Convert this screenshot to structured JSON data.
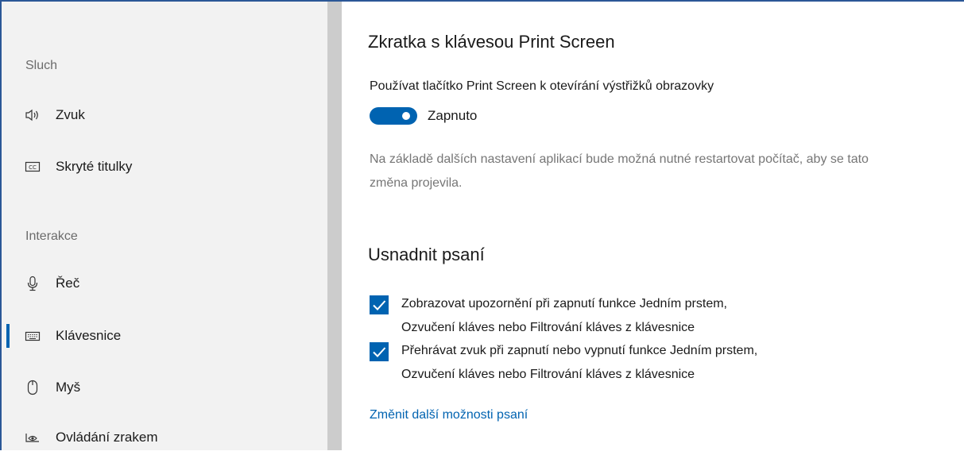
{
  "sidebar": {
    "groups": [
      {
        "label": "Sluch",
        "items": [
          {
            "label": "Zvuk",
            "icon": "speaker-icon"
          },
          {
            "label": "Skryté titulky",
            "icon": "closed-captions-icon"
          }
        ]
      },
      {
        "label": "Interakce",
        "items": [
          {
            "label": "Řeč",
            "icon": "microphone-icon"
          },
          {
            "label": "Klávesnice",
            "icon": "keyboard-icon",
            "selected": true
          },
          {
            "label": "Myš",
            "icon": "mouse-icon"
          },
          {
            "label": "Ovládání zrakem",
            "icon": "eye-control-icon"
          }
        ]
      }
    ]
  },
  "main": {
    "print_screen": {
      "heading": "Zkratka s klávesou Print Screen",
      "setting_label": "Používat tlačítko Print Screen k otevírání výstřižků obrazovky",
      "toggle_state": "Zapnuto",
      "toggle_on": true,
      "note": "Na základě dalších nastavení aplikací bude možná nutné restartovat počítač, aby se tato změna projevila."
    },
    "typing": {
      "heading": "Usnadnit psaní",
      "checkboxes": [
        {
          "line1": "Zobrazovat upozornění při zapnutí funkce Jedním prstem,",
          "line2": "Ozvučení kláves nebo Filtrování kláves z klávesnice",
          "checked": true
        },
        {
          "line1": "Přehrávat zvuk při zapnutí nebo vypnutí funkce Jedním prstem,",
          "line2": "Ozvučení kláves nebo Filtrování kláves z klávesnice",
          "checked": true
        }
      ],
      "link": "Změnit další možnosti psaní"
    }
  },
  "colors": {
    "accent": "#0063b1",
    "sidebar_bg": "#f2f2f2",
    "divider": "#cccccc",
    "muted_text": "#767676"
  }
}
